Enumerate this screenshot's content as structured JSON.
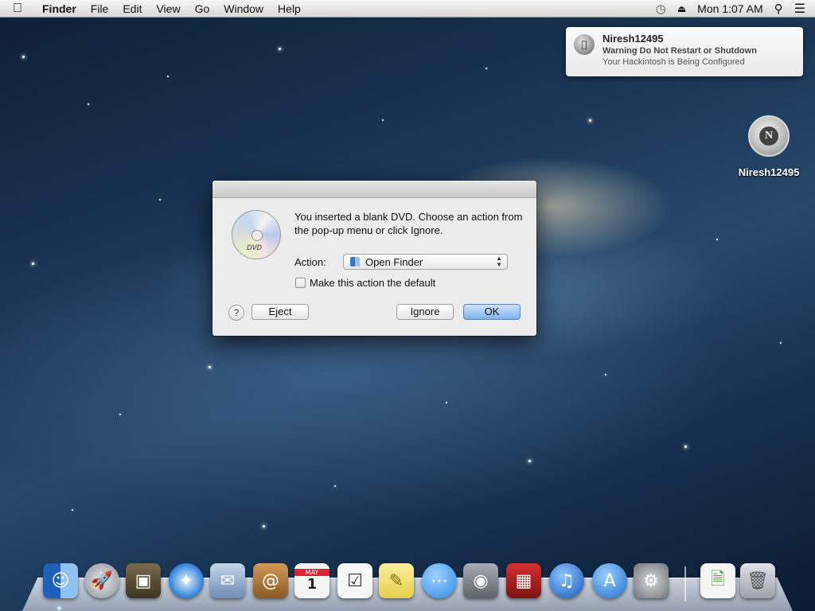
{
  "menubar": {
    "apple_icon": "apple-logo",
    "items": [
      "Finder",
      "File",
      "Edit",
      "View",
      "Go",
      "Window",
      "Help"
    ],
    "clock": "Mon 1:07 AM",
    "status_icons": [
      "time-machine-icon",
      "eject-icon",
      "spotlight-search-icon",
      "notification-center-icon"
    ]
  },
  "notification": {
    "title": "Niresh12495",
    "line1": "Warning Do Not Restart or Shutdown",
    "line2": "Your Hackintosh is Being Configured"
  },
  "desktop_icon": {
    "label": "Niresh12495",
    "glyph": "N"
  },
  "dialog": {
    "message": "You inserted a blank DVD. Choose an action from the pop-up menu or click Ignore.",
    "dvd_label": "DVD",
    "action_label": "Action:",
    "action_value": "Open Finder",
    "checkbox_label": "Make this action the default",
    "checkbox_checked": false,
    "help_label": "?",
    "eject_label": "Eject",
    "ignore_label": "Ignore",
    "ok_label": "OK",
    "accent_color": "#7fb1ea"
  },
  "dock": {
    "apps": [
      {
        "name": "finder-icon",
        "color": "#3a7bd5"
      },
      {
        "name": "launchpad-icon",
        "color": "#b8bcc4"
      },
      {
        "name": "photo-browser-icon",
        "color": "#6a5a3c"
      },
      {
        "name": "safari-icon",
        "color": "#2b7fd9"
      },
      {
        "name": "mail-icon",
        "color": "#8fa8c8"
      },
      {
        "name": "contacts-icon",
        "color": "#b07a3a"
      },
      {
        "name": "calendar-icon",
        "color": "#f2f2f2"
      },
      {
        "name": "reminders-icon",
        "color": "#f4f4f4"
      },
      {
        "name": "notes-icon",
        "color": "#f6e27a"
      },
      {
        "name": "messages-icon",
        "color": "#4aa3ec"
      },
      {
        "name": "facetime-icon",
        "color": "#8a8f97"
      },
      {
        "name": "photo-booth-icon",
        "color": "#b11f1f"
      },
      {
        "name": "itunes-icon",
        "color": "#1f6fd0"
      },
      {
        "name": "app-store-icon",
        "color": "#2a86e0"
      },
      {
        "name": "system-preferences-icon",
        "color": "#8c8f94"
      },
      {
        "name": "documents-stack-icon",
        "color": "#f2f2f2"
      },
      {
        "name": "trash-icon",
        "color": "#c8ccd2"
      }
    ],
    "calendar_month": "MAY",
    "calendar_day": "1"
  }
}
